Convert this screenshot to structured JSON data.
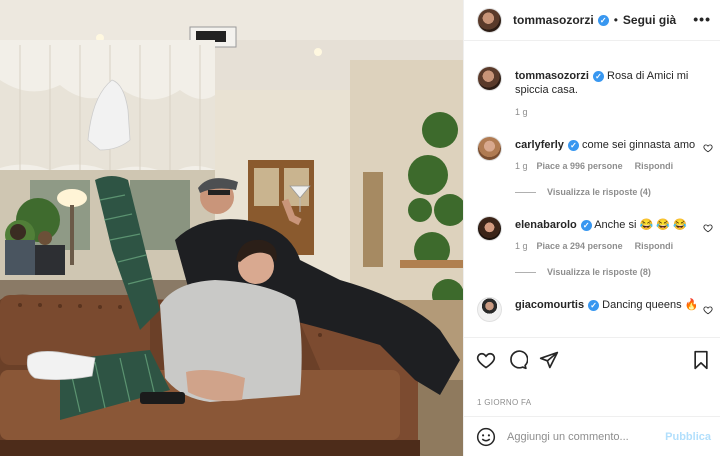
{
  "post": {
    "author": {
      "username": "tommasozorzi",
      "follow_label": "Segui già",
      "dot": "•",
      "more": "•••"
    },
    "caption": {
      "username": "tommasozorzi",
      "text": "Rosa di Amici mi spiccia casa.",
      "time": "1 g"
    },
    "comments": [
      {
        "username": "carlyferly",
        "text": "come sei ginnasta amo",
        "time": "1 g",
        "likes": "Piace a 996 persone",
        "reply": "Rispondi",
        "view_replies": "Visualizza le risposte (4)"
      },
      {
        "username": "elenabarolo",
        "text": "Anche si 😂 😂 😂",
        "time": "1 g",
        "likes": "Piace a 294 persone",
        "reply": "Rispondi",
        "view_replies": "Visualizza le risposte (8)"
      },
      {
        "username": "giacomourtis",
        "text": "Dancing queens 🔥"
      }
    ],
    "time_ago": "1 GIORNO FA",
    "add_comment": {
      "placeholder": "Aggiungi un commento...",
      "publish": "Pubblica"
    },
    "icons": [
      "heart-icon",
      "comment-icon",
      "share-icon",
      "bookmark-icon",
      "emoji-icon",
      "verified-icon",
      "more-icon"
    ],
    "colors": {
      "verified": "#3897f0",
      "publish_disabled": "#b2dffc",
      "text": "#262626",
      "muted": "#8e8e8e"
    }
  }
}
